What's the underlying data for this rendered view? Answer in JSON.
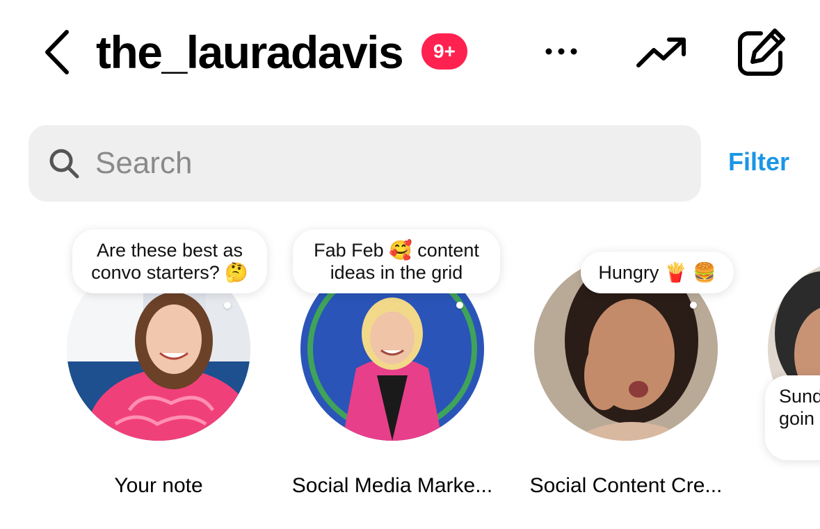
{
  "header": {
    "username": "the_lauradavis",
    "badge": "9+",
    "icons": [
      "chevron-left-icon",
      "more-icon",
      "trending-icon",
      "compose-icon"
    ],
    "badge_color": "#ff2150"
  },
  "search": {
    "placeholder": "Search",
    "value": "",
    "filter_label": "Filter",
    "accent_color": "#1a96e6"
  },
  "notes": [
    {
      "label": "Your note",
      "note_line1": "Are these best as",
      "note_line2": "convo starters? 🤔"
    },
    {
      "label": "Social Media Marke...",
      "note_line1": "Fab Feb 🥰 content",
      "note_line2": "ideas in the grid"
    },
    {
      "label": "Social Content Cre...",
      "note_line1": "Hungry 🍟 🍔"
    },
    {
      "label": "",
      "note_line1": "Sund",
      "note_line2": "goin"
    }
  ]
}
